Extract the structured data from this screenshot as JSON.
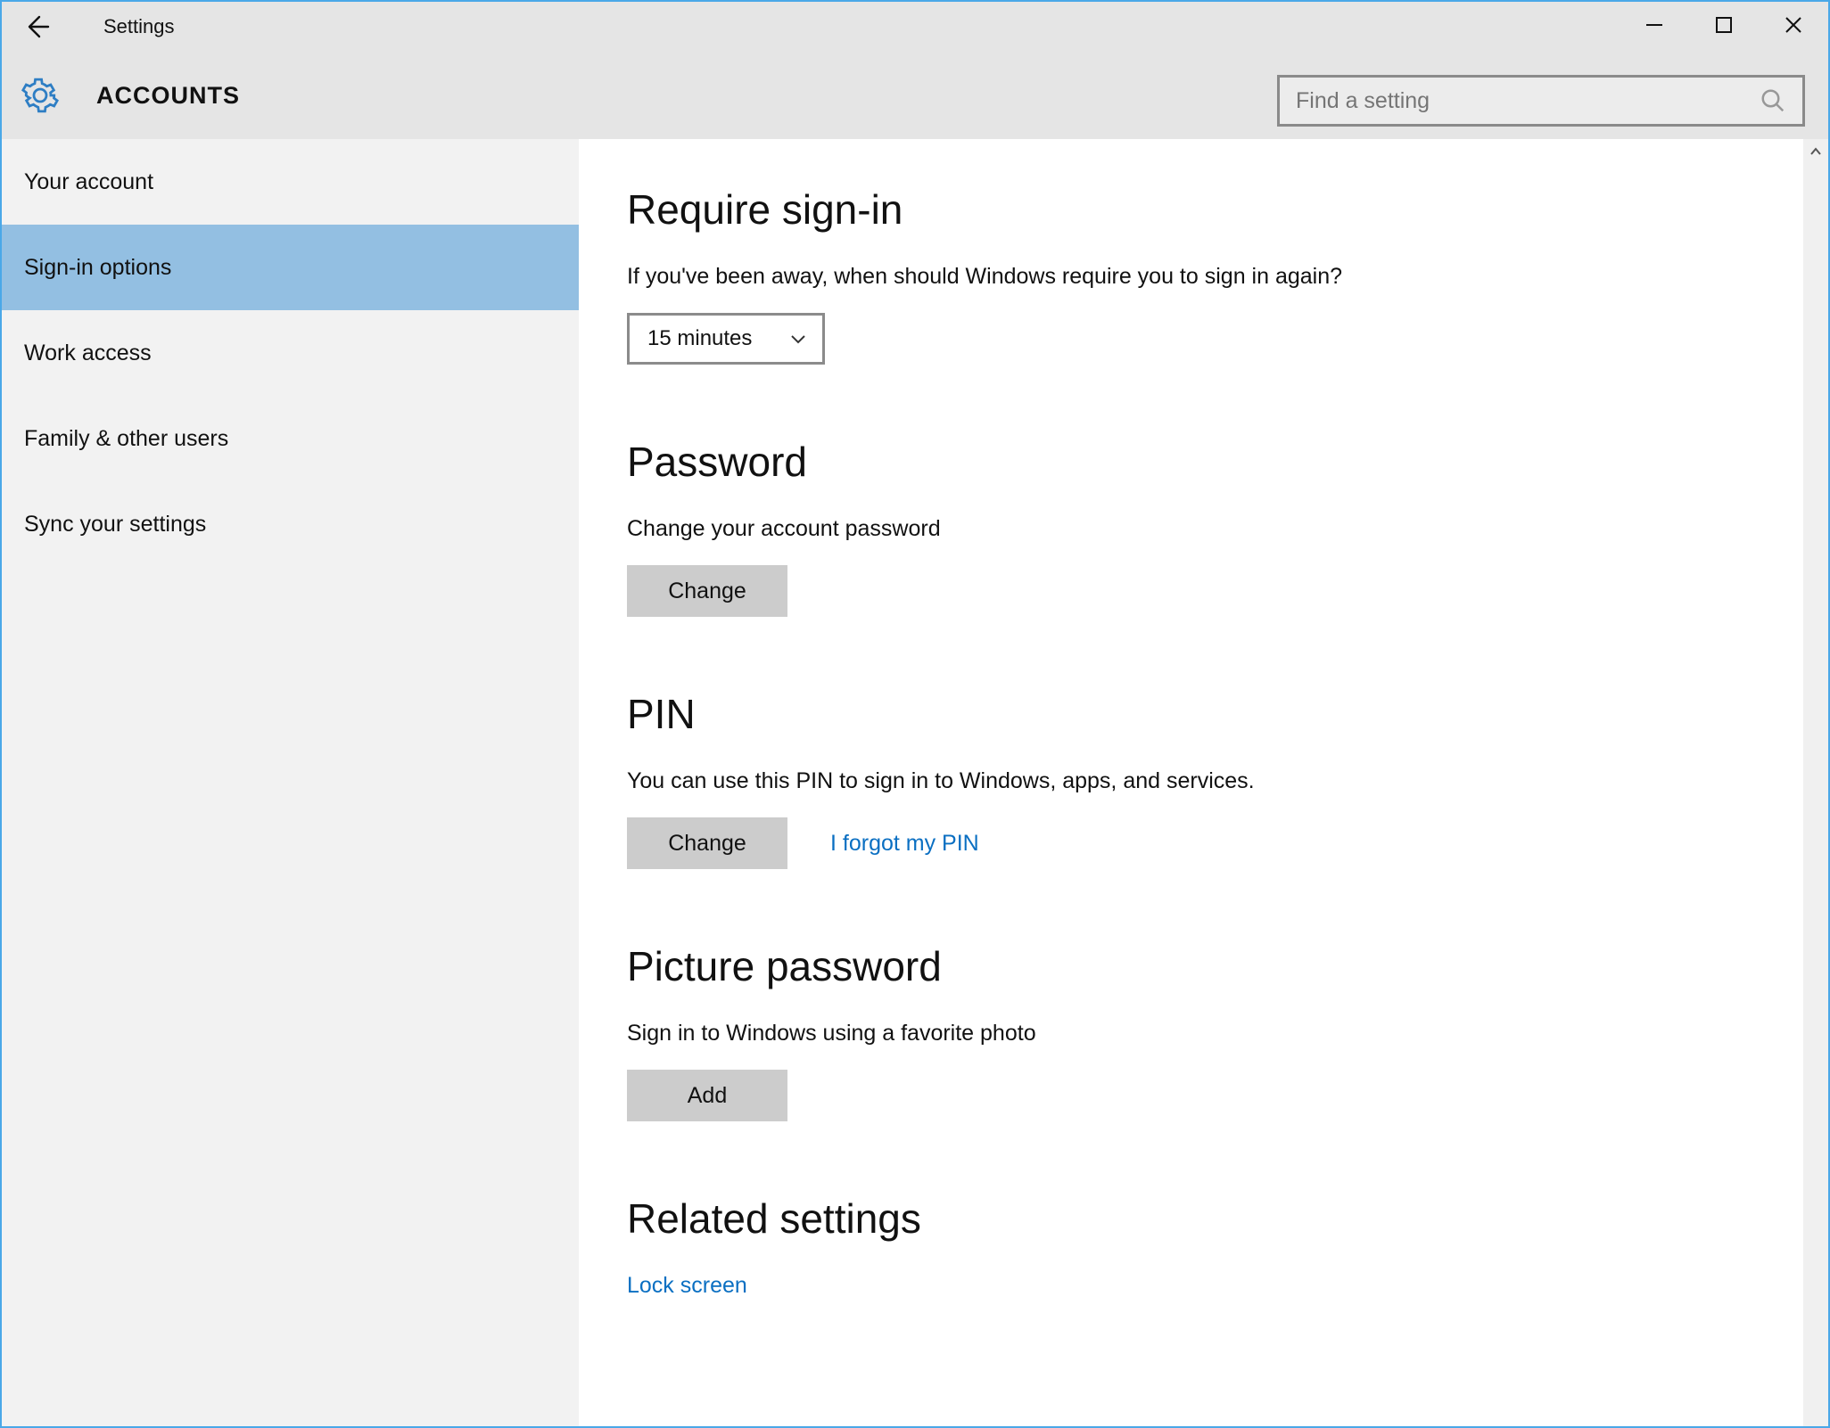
{
  "window": {
    "title": "Settings"
  },
  "header": {
    "category": "ACCOUNTS",
    "search_placeholder": "Find a setting"
  },
  "sidebar": {
    "items": [
      {
        "label": "Your account",
        "selected": false
      },
      {
        "label": "Sign-in options",
        "selected": true
      },
      {
        "label": "Work access",
        "selected": false
      },
      {
        "label": "Family & other users",
        "selected": false
      },
      {
        "label": "Sync your settings",
        "selected": false
      }
    ]
  },
  "require_signin": {
    "heading": "Require sign-in",
    "desc": "If you've been away, when should Windows require you to sign in again?",
    "selected": "15 minutes"
  },
  "password": {
    "heading": "Password",
    "desc": "Change your account password",
    "button": "Change"
  },
  "pin": {
    "heading": "PIN",
    "desc": "You can use this PIN to sign in to Windows, apps, and services.",
    "button": "Change",
    "forgot": "I forgot my PIN"
  },
  "picture_password": {
    "heading": "Picture password",
    "desc": "Sign in to Windows using a favorite photo",
    "button": "Add"
  },
  "related": {
    "heading": "Related settings",
    "lock_screen": "Lock screen"
  }
}
